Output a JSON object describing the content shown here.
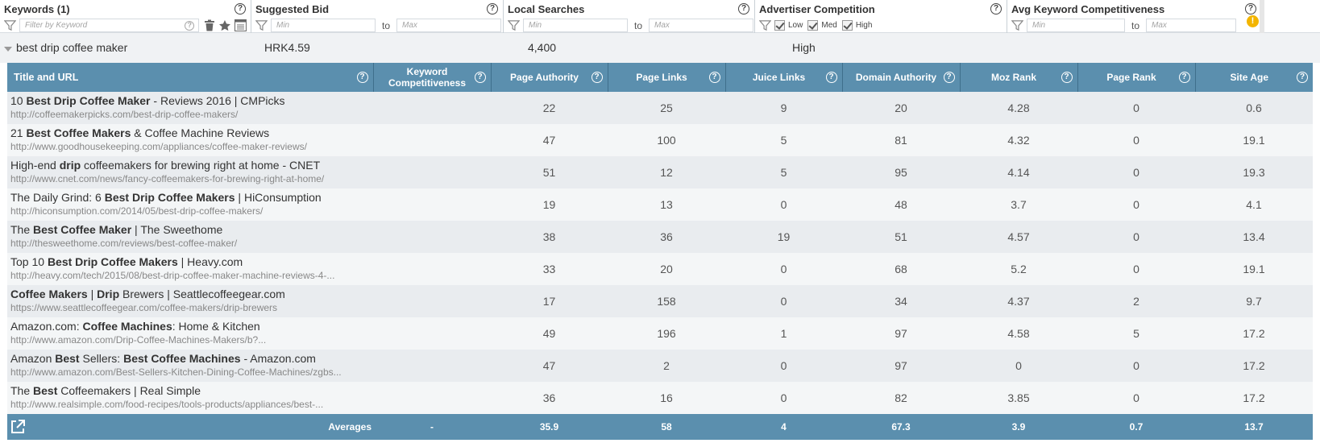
{
  "filters": {
    "keywords": {
      "title": "Keywords (1)",
      "placeholder": "Filter by Keyword"
    },
    "suggested_bid": {
      "title": "Suggested Bid",
      "min_placeholder": "Min",
      "to": "to",
      "max_placeholder": "Max"
    },
    "local_searches": {
      "title": "Local Searches",
      "min_placeholder": "Min",
      "to": "to",
      "max_placeholder": "Max"
    },
    "advertiser_competition": {
      "title": "Advertiser Competition",
      "options": [
        "Low",
        "Med",
        "High"
      ]
    },
    "avg_kc": {
      "title": "Avg Keyword Competitiveness",
      "min_placeholder": "Min",
      "to": "to",
      "max_placeholder": "Max",
      "warning": "!"
    },
    "help": "?"
  },
  "keyword_row": {
    "keyword": "best drip coffee maker",
    "bid": "HRK4.59",
    "searches": "4,400",
    "competition": "High"
  },
  "table": {
    "headers": {
      "title_url": "Title and URL",
      "kc": "Keyword Competitiveness",
      "pa": "Page Authority",
      "pl": "Page Links",
      "jl": "Juice Links",
      "da": "Domain Authority",
      "mr": "Moz Rank",
      "pr": "Page Rank",
      "sa": "Site Age"
    },
    "rows": [
      {
        "title": [
          [
            "10 ",
            false
          ],
          [
            "Best Drip Coffee Maker",
            true
          ],
          [
            " - Reviews 2016 | CMPicks",
            false
          ]
        ],
        "url": "http://coffeemakerpicks.com/best-drip-coffee-makers/",
        "kc": "",
        "pa": "22",
        "pl": "25",
        "jl": "9",
        "da": "20",
        "mr": "4.28",
        "pr": "0",
        "sa": "0.6"
      },
      {
        "title": [
          [
            "21 ",
            false
          ],
          [
            "Best Coffee Makers",
            true
          ],
          [
            " & Coffee Machine Reviews",
            false
          ]
        ],
        "url": "http://www.goodhousekeeping.com/appliances/coffee-maker-reviews/",
        "kc": "",
        "pa": "47",
        "pl": "100",
        "jl": "5",
        "da": "81",
        "mr": "4.32",
        "pr": "0",
        "sa": "19.1"
      },
      {
        "title": [
          [
            "High-end ",
            false
          ],
          [
            "drip",
            true
          ],
          [
            " coffeemakers for brewing right at home - CNET",
            false
          ]
        ],
        "url": "http://www.cnet.com/news/fancy-coffeemakers-for-brewing-right-at-home/",
        "kc": "",
        "pa": "51",
        "pl": "12",
        "jl": "5",
        "da": "95",
        "mr": "4.14",
        "pr": "0",
        "sa": "19.3"
      },
      {
        "title": [
          [
            "The Daily Grind: 6 ",
            false
          ],
          [
            "Best Drip Coffee Makers",
            true
          ],
          [
            " | HiConsumption",
            false
          ]
        ],
        "url": "http://hiconsumption.com/2014/05/best-drip-coffee-makers/",
        "kc": "",
        "pa": "19",
        "pl": "13",
        "jl": "0",
        "da": "48",
        "mr": "3.7",
        "pr": "0",
        "sa": "4.1"
      },
      {
        "title": [
          [
            "The ",
            false
          ],
          [
            "Best Coffee Maker",
            true
          ],
          [
            " | The Sweethome",
            false
          ]
        ],
        "url": "http://thesweethome.com/reviews/best-coffee-maker/",
        "kc": "",
        "pa": "38",
        "pl": "36",
        "jl": "19",
        "da": "51",
        "mr": "4.57",
        "pr": "0",
        "sa": "13.4"
      },
      {
        "title": [
          [
            "Top 10 ",
            false
          ],
          [
            "Best Drip Coffee Makers",
            true
          ],
          [
            " | Heavy.com",
            false
          ]
        ],
        "url": "http://heavy.com/tech/2015/08/best-drip-coffee-maker-machine-reviews-4-...",
        "kc": "",
        "pa": "33",
        "pl": "20",
        "jl": "0",
        "da": "68",
        "mr": "5.2",
        "pr": "0",
        "sa": "19.1"
      },
      {
        "title": [
          [
            "Coffee Makers",
            true
          ],
          [
            " | ",
            false
          ],
          [
            "Drip",
            true
          ],
          [
            " Brewers | Seattlecoffeegear.com",
            false
          ]
        ],
        "url": "https://www.seattlecoffeegear.com/coffee-makers/drip-brewers",
        "kc": "",
        "pa": "17",
        "pl": "158",
        "jl": "0",
        "da": "34",
        "mr": "4.37",
        "pr": "2",
        "sa": "9.7"
      },
      {
        "title": [
          [
            "Amazon.com: ",
            false
          ],
          [
            "Coffee Machines",
            true
          ],
          [
            ": Home & Kitchen",
            false
          ]
        ],
        "url": "http://www.amazon.com/Drip-Coffee-Machines-Makers/b?...",
        "kc": "",
        "pa": "49",
        "pl": "196",
        "jl": "1",
        "da": "97",
        "mr": "4.58",
        "pr": "5",
        "sa": "17.2"
      },
      {
        "title": [
          [
            "Amazon ",
            false
          ],
          [
            "Best",
            true
          ],
          [
            " Sellers: ",
            false
          ],
          [
            "Best Coffee Machines",
            true
          ],
          [
            " - Amazon.com",
            false
          ]
        ],
        "url": "http://www.amazon.com/Best-Sellers-Kitchen-Dining-Coffee-Machines/zgbs...",
        "kc": "",
        "pa": "47",
        "pl": "2",
        "jl": "0",
        "da": "97",
        "mr": "0",
        "pr": "0",
        "sa": "17.2"
      },
      {
        "title": [
          [
            "The ",
            false
          ],
          [
            "Best",
            true
          ],
          [
            " Coffeemakers | Real Simple",
            false
          ]
        ],
        "url": "http://www.realsimple.com/food-recipes/tools-products/appliances/best-...",
        "kc": "",
        "pa": "36",
        "pl": "16",
        "jl": "0",
        "da": "82",
        "mr": "3.85",
        "pr": "0",
        "sa": "17.2"
      }
    ],
    "averages": {
      "label": "Averages",
      "kc": "-",
      "pa": "35.9",
      "pl": "58",
      "jl": "4",
      "da": "67.3",
      "mr": "3.9",
      "pr": "0.7",
      "sa": "13.7"
    }
  },
  "colors": {
    "header_bg": "#5b8fae",
    "row_odd": "#e9ecef",
    "row_even": "#f4f6f7",
    "warning": "#f3b500"
  },
  "icons": [
    "funnel-icon",
    "help-icon",
    "trash-icon",
    "star-icon",
    "list-icon",
    "checkbox-icon",
    "warning-icon",
    "export-icon",
    "caret-down-icon"
  ]
}
